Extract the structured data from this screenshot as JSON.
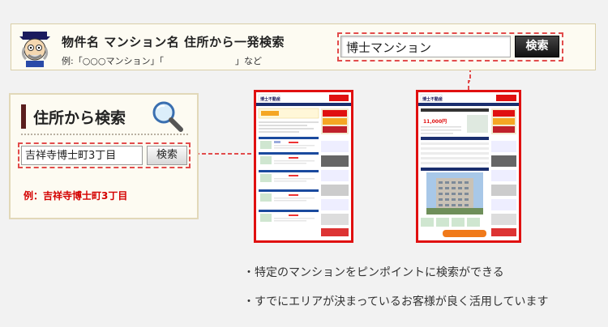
{
  "banner": {
    "title": "物件名 マンション名 住所から一発検索",
    "example": "例:「○○○マンション」「　　　　　　　　」など",
    "search_value": "博士マンション",
    "search_button": "検索"
  },
  "left_widget": {
    "title": "住所から検索",
    "search_value": "吉祥寺博士町3丁目",
    "search_button": "検索",
    "example": "例：吉祥寺博士町3丁目"
  },
  "thumbnails": {
    "site_logo": "博士不動産",
    "price_sample": "11,000円"
  },
  "bullets": [
    "・特定のマンションをピンポイントに検索ができる",
    "・すでにエリアが決まっているお客様が良く活用しています"
  ],
  "colors": {
    "accent_red": "#e01010",
    "dash_red": "#e24c4c",
    "panel_bg": "#fdfbf2",
    "button_dark": "#222222"
  }
}
